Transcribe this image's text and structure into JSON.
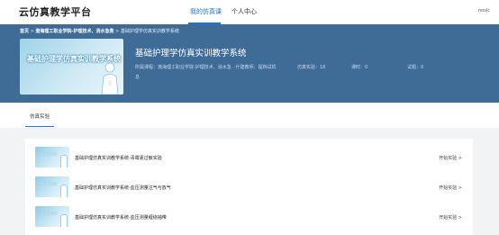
{
  "header": {
    "logo": "云仿真教学平台",
    "nav": [
      {
        "label": "我的仿真课"
      },
      {
        "label": "个人中心"
      }
    ],
    "user": "noslc"
  },
  "breadcrumb": {
    "home": "首页",
    "school": "渤海理工职业学院-护理技术、消水急救",
    "sep": ">",
    "current": "基础护理学仿真实训教学系统"
  },
  "course": {
    "cover_text": "基础护理学仿真实训教学系统",
    "title": "基础护理学仿真实训教学系统",
    "meta_school": "所属课程：渤海理工职业学院-护理技术、消水急 · 什建教师：提档试机",
    "meta_exp": "仿真实验：18",
    "meta_hours": "课时：0",
    "meta_tests": "试题：0",
    "meta_extra": "息"
  },
  "tabs": [
    {
      "label": "仿真实验"
    }
  ],
  "experiments": [
    {
      "thumb_text": "基础护理学仿真",
      "name": "基础护理仿真实训教学系统-青霉素过敏实验",
      "action": "开始实验 >"
    },
    {
      "thumb_text": "基础护理学仿真",
      "name": "基础护理仿真实训教学系统-血压测量注气与放气",
      "action": "开始实验 >"
    },
    {
      "thumb_text": "基础护理学仿真",
      "name": "基础护理仿真实训教学系统-血压测量缠绕袖带",
      "action": "开始实验 >"
    }
  ],
  "colors": {
    "accent": "#1a73e8",
    "banner": "#3f6b97"
  }
}
